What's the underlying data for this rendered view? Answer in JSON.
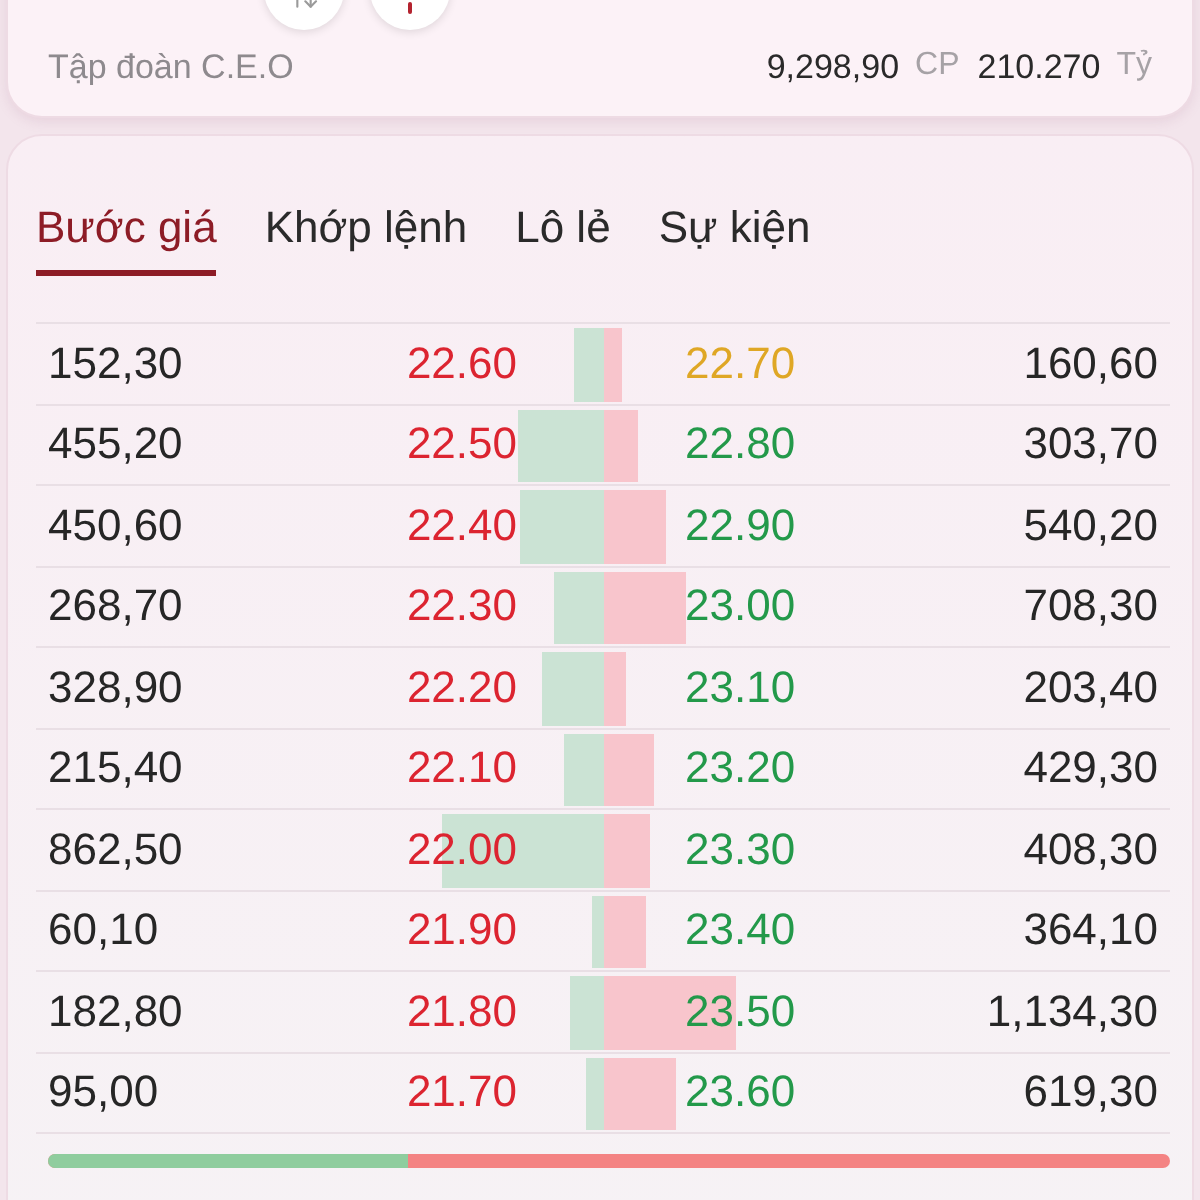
{
  "header": {
    "company": "Tập đoàn C.E.O",
    "volume": "9,298,90",
    "volume_unit": "CP",
    "value": "210.270",
    "value_unit": "Tỷ"
  },
  "tabs": [
    {
      "label": "Bước giá",
      "selected": true
    },
    {
      "label": "Khớp lệnh",
      "selected": false
    },
    {
      "label": "Lô lẻ",
      "selected": false
    },
    {
      "label": "Sự kiện",
      "selected": false
    }
  ],
  "order_book": {
    "rows": [
      {
        "bid": {
          "volume": "152,30",
          "price": "22.60",
          "color": "#dc2430"
        },
        "ask": {
          "price": "22.70",
          "color": "#dfa725",
          "volume": "160,60"
        }
      },
      {
        "bid": {
          "volume": "455,20",
          "price": "22.50",
          "color": "#dc2430"
        },
        "ask": {
          "price": "22.80",
          "color": "#23994a",
          "volume": "303,70"
        }
      },
      {
        "bid": {
          "volume": "450,60",
          "price": "22.40",
          "color": "#dc2430"
        },
        "ask": {
          "price": "22.90",
          "color": "#23994a",
          "volume": "540,20"
        }
      },
      {
        "bid": {
          "volume": "268,70",
          "price": "22.30",
          "color": "#dc2430"
        },
        "ask": {
          "price": "23.00",
          "color": "#23994a",
          "volume": "708,30"
        }
      },
      {
        "bid": {
          "volume": "328,90",
          "price": "22.20",
          "color": "#dc2430"
        },
        "ask": {
          "price": "23.10",
          "color": "#23994a",
          "volume": "203,40"
        }
      },
      {
        "bid": {
          "volume": "215,40",
          "price": "22.10",
          "color": "#dc2430"
        },
        "ask": {
          "price": "23.20",
          "color": "#23994a",
          "volume": "429,30"
        }
      },
      {
        "bid": {
          "volume": "862,50",
          "price": "22.00",
          "color": "#dc2430"
        },
        "ask": {
          "price": "23.30",
          "color": "#23994a",
          "volume": "408,30"
        }
      },
      {
        "bid": {
          "volume": "60,10",
          "price": "21.90",
          "color": "#dc2430"
        },
        "ask": {
          "price": "23.40",
          "color": "#23994a",
          "volume": "364,10"
        }
      },
      {
        "bid": {
          "volume": "182,80",
          "price": "21.80",
          "color": "#dc2430"
        },
        "ask": {
          "price": "23.50",
          "color": "#23994a",
          "volume": "1,134,30"
        }
      },
      {
        "bid": {
          "volume": "95,00",
          "price": "21.70",
          "color": "#dc2430"
        },
        "ask": {
          "price": "23.60",
          "color": "#23994a",
          "volume": "619,30"
        }
      }
    ],
    "balance": {
      "level": 0.32
    }
  }
}
